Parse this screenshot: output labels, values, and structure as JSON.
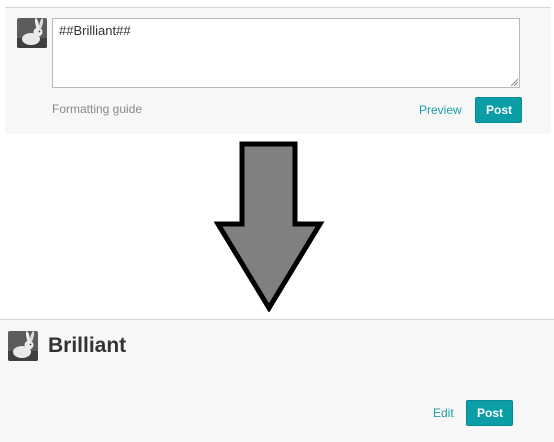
{
  "compose": {
    "editor_value": "##Brilliant##",
    "formatting_guide_label": "Formatting guide",
    "preview_label": "Preview",
    "post_label": "Post"
  },
  "arrow": {
    "fill_color": "#808080",
    "stroke_color": "#000000"
  },
  "result": {
    "heading": "Brilliant",
    "edit_label": "Edit",
    "post_label": "Post"
  },
  "colors": {
    "accent": "#0b9ea6",
    "link": "#1aa0a8",
    "panel_bg": "#f7f7f7"
  },
  "icons": {
    "avatar": "rabbit-avatar-icon"
  }
}
